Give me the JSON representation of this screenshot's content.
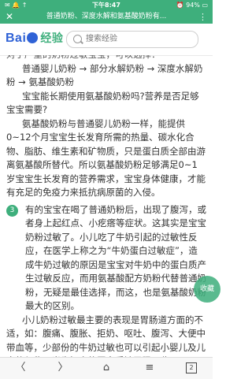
{
  "status_bar": {
    "left_icons": "✉ 🔔 ↑",
    "time": "下午8:47",
    "right": "⏰ 94% ▭"
  },
  "title_bar": {
    "close_icon": "✕",
    "title": "普通奶粉、深度水解和氨基酸奶粉有...",
    "more_icon": "⋮"
  },
  "header": {
    "logo_text_a": "Bai",
    "logo_text_b": "经验",
    "search_placeholder": "搜索经验"
  },
  "content": {
    "cut_line": "对于严重的奶粉过敏宝宝，可以选择：",
    "p1": "普通婴儿奶粉 → 部分水解奶粉 → 深度水解奶粉 → 氨基酸奶粉",
    "p2": "宝宝能长期使用氨基酸奶粉吗?营养是否足够宝宝需要?",
    "p3": "氨基酸奶粉与普通婴儿奶粉一样，能提供0~12个月宝宝生长发育所需的热量、碳水化合物、脂肪、维生素和矿物质，只是蛋白质全部由游离氨基酸所替代。所以氨基酸奶粉足够满足0~1岁宝宝生长发育的营养需求，宝宝身体健康，才能有充足的免疫力来抵抗病原菌的入侵。",
    "step_number": "3",
    "step_text": "有的宝宝在喝了普通奶粉后，出现了腹泻，或者身上起红点、小疙瘩等症状。这其实是宝宝奶粉过敏了。小儿吃了牛奶引起的过敏性反应，在医学上称之为“牛奶蛋白过敏症”，造成牛奶过敏的原因是宝宝对牛奶中的蛋白质产生过敏反应，而用氨基酸配方奶粉代替普通奶粉，无疑是最佳选择，而这，也是氨基酸奶粉最大的区别。",
    "p4": "小儿奶粉过敏最主要的表现是胃肠道方面的不适，如：腹痛、腹胀、拒奶、呕吐、腹泻、大便中带血等，少部份的牛奶过敏也可以引起小婴儿及儿童的便秘。当牛奶中的蛋白质被胃肠吸收"
  },
  "fab": {
    "label": "收藏"
  },
  "bottom_nav": {
    "back_icon": "〈",
    "forward_icon": "〉",
    "home_icon": "⌂",
    "menu_icon": "≡",
    "tab_count": "2"
  }
}
